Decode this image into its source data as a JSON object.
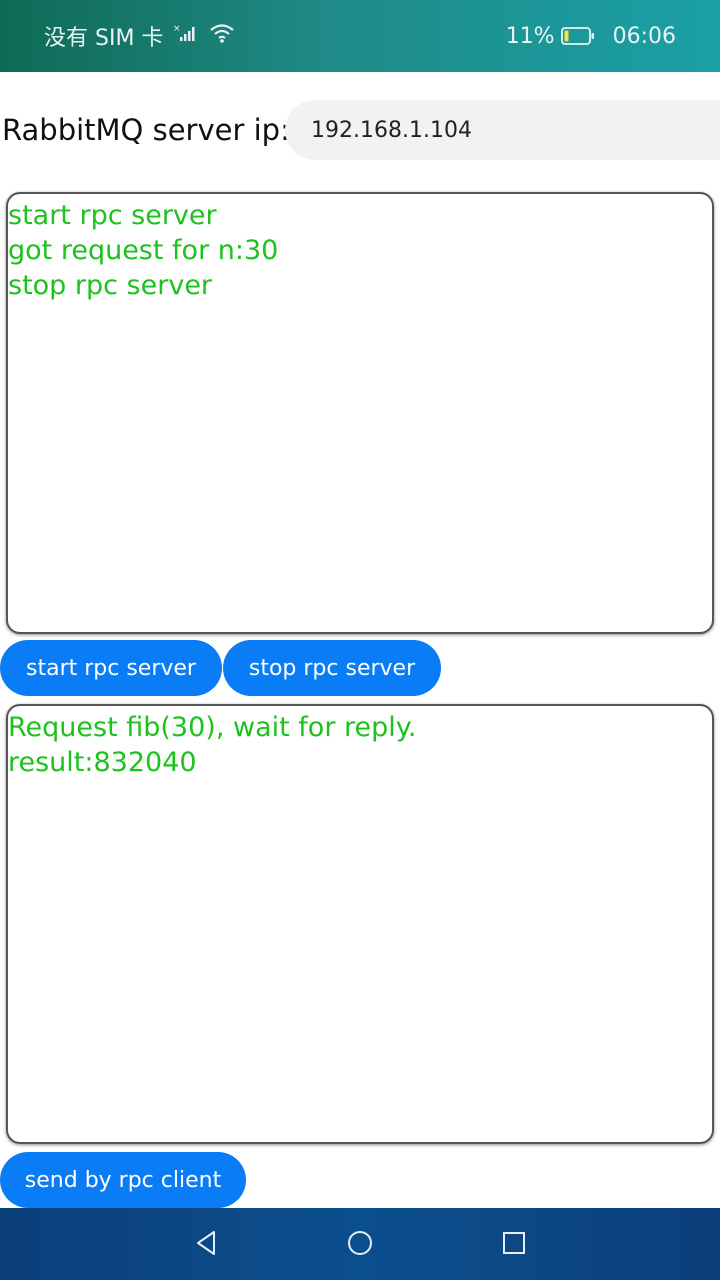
{
  "status_bar": {
    "carrier": "没有 SIM 卡",
    "battery_percent": "11%",
    "time": "06:06",
    "icons": [
      "no-sim-signal-icon",
      "wifi-icon",
      "battery-icon"
    ]
  },
  "server_ip": {
    "label": "RabbitMQ server ip:",
    "value": "192.168.1.104"
  },
  "server_log": {
    "lines": [
      "start rpc server",
      "got request for n:30",
      "stop rpc server"
    ]
  },
  "buttons": {
    "start_server": "start rpc server",
    "stop_server": "stop rpc server",
    "send_client": "send by rpc client"
  },
  "client_log": {
    "lines": [
      "Request fib(30), wait for reply.",
      "result:832040"
    ]
  },
  "navigation": {
    "icons": [
      "back-icon",
      "home-icon",
      "recents-icon"
    ]
  },
  "colors": {
    "log_text": "#1ec21e",
    "button": "#0a7cf5"
  }
}
